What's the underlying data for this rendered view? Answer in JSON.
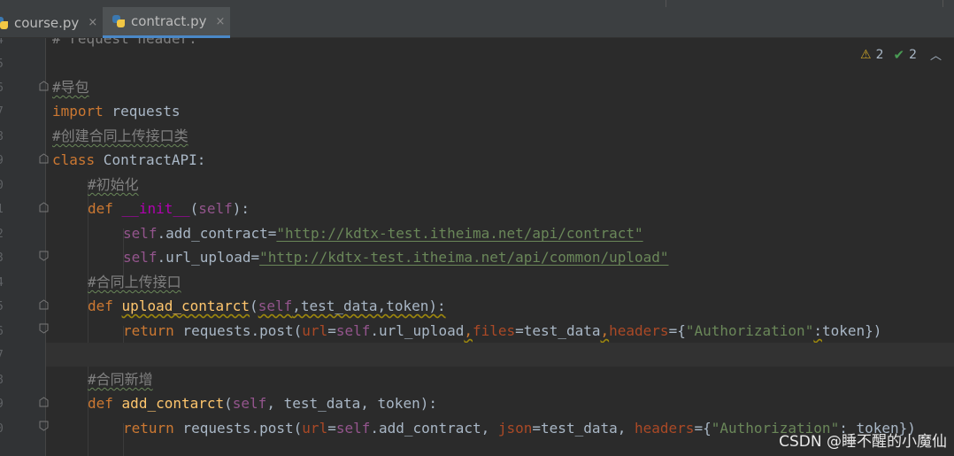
{
  "tabs": [
    {
      "label": "course.py",
      "active": false
    },
    {
      "label": "contract.py",
      "active": true
    }
  ],
  "tab_close_glyph": "×",
  "inspections": {
    "warnings": "2",
    "weak_warnings": "2"
  },
  "gutter_line_numbers": [
    "4",
    "5",
    "6",
    "7",
    "8",
    "9",
    "0",
    "1",
    "2",
    "3",
    "4",
    "5",
    "6",
    "7",
    "8",
    "9",
    "0"
  ],
  "code": {
    "l0": "# request header:",
    "l2_comment": "#导包",
    "l3_kw": "import",
    "l3_mod": " requests",
    "l4_comment": "#创建合同上传接口类",
    "l5_kw": "class",
    "l5_name": " ContractAPI",
    "l5_end": ":",
    "l6_comment": "#初始化",
    "l7_kw": "def",
    "l7_sp": " ",
    "l7_fn": "__init__",
    "l7_open": "(",
    "l7_self": "self",
    "l7_close": "):",
    "l8_self": "self",
    "l8_attr": ".add_contract",
    "l8_eq": "=",
    "l8_str": "\"http://kdtx-test.itheima.net/api/contract\"",
    "l9_self": "self",
    "l9_attr": ".url_upload",
    "l9_eq": "=",
    "l9_str": "\"http://kdtx-test.itheima.net/api/common/upload\"",
    "l10_comment": "#合同上传接口",
    "l11_kw": "def",
    "l11_fn": "upload_contarct",
    "l11_open": "(",
    "l11_self": "self",
    "l11_rest": ",test_data,token):",
    "l12_kw": "return",
    "l12_a": " requests.post(",
    "l12_p1": "url",
    "l12_b": "=",
    "l12_self": "self",
    "l12_c": ".url_upload",
    "l12_comma1": ",",
    "l12_p2": "files",
    "l12_d": "=test_data",
    "l12_comma2": ",",
    "l12_p3": "headers",
    "l12_e": "={",
    "l12_str": "\"Authorization\"",
    "l12_colon": ":",
    "l12_f": "token})",
    "l14_comment": "#合同新增",
    "l15_kw": "def",
    "l15_fn": "add_contarct",
    "l15_open": "(",
    "l15_self": "self",
    "l15_rest": ", test_data, token):",
    "l16_kw": "return",
    "l16_a": " requests.post(",
    "l16_p1": "url",
    "l16_b": "=",
    "l16_self": "self",
    "l16_c": ".add_contract, ",
    "l16_p2": "json",
    "l16_d": "=test_data, ",
    "l16_p3": "headers",
    "l16_e": "={",
    "l16_str": "\"Authorization\"",
    "l16_f": ": token})"
  },
  "watermark": "CSDN @睡不醒的小魔仙"
}
